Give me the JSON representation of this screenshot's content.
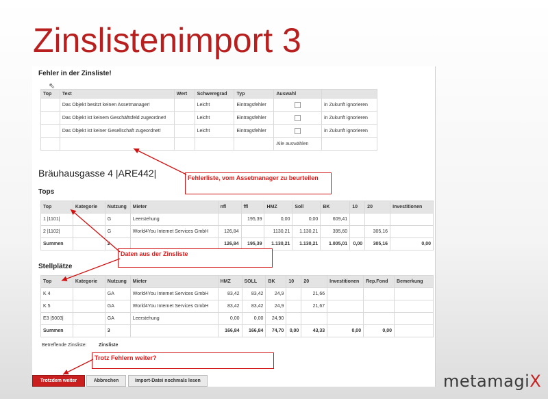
{
  "slide": {
    "title": "Zinslistenimport 3",
    "logo_main": "metamagi",
    "logo_accent": "X"
  },
  "errors": {
    "heading": "Fehler in der Zinsliste!",
    "columns": [
      "Top",
      "Text",
      "Wert",
      "Schweregrad",
      "Typ",
      "Auswahl",
      ""
    ],
    "rows": [
      {
        "top": "",
        "text": "Das Objekt besitzt keinen Assetmanager!",
        "wert": "",
        "severity": "Leicht",
        "typ": "Eintragsfehler",
        "ignore": "in Zukunft ignorieren"
      },
      {
        "top": "",
        "text": "Das Objekt ist keinem Geschäftsfeld zugeordnet!",
        "wert": "",
        "severity": "Leicht",
        "typ": "Eintragsfehler",
        "ignore": "in Zukunft ignorieren"
      },
      {
        "top": "",
        "text": "Das Objekt ist keiner Gesellschaft zugeordnet!",
        "wert": "",
        "severity": "Leicht",
        "typ": "Eintragsfehler",
        "ignore": "in Zukunft ignorieren"
      }
    ],
    "select_all": "Alle auswählen"
  },
  "object_title": "Bräuhausgasse 4 |ARE442|",
  "tops": {
    "heading": "Tops",
    "columns": [
      "Top",
      "Kategorie",
      "Nutzung",
      "Mieter",
      "nfl",
      "ffl",
      "HMZ",
      "Soll",
      "BK",
      "10",
      "20",
      "Investitionen"
    ],
    "rows": [
      [
        "1 |1101|",
        "",
        "G",
        "Leerstehung",
        "",
        "195,39",
        "0,00",
        "0,00",
        "609,41",
        "",
        "",
        ""
      ],
      [
        "2 |1102|",
        "",
        "G",
        "World4You Internet Services GmbH",
        "126,84",
        "",
        "1130,21",
        "1.130,21",
        "395,60",
        "",
        "305,16",
        ""
      ]
    ],
    "sum": [
      "Summen",
      "",
      "2",
      "",
      "126,84",
      "195,39",
      "1.130,21",
      "1.130,21",
      "1.005,01",
      "0,00",
      "305,16",
      "0,00"
    ]
  },
  "parking": {
    "heading": "Stellplätze",
    "columns": [
      "Top",
      "Kategorie",
      "Nutzung",
      "Mieter",
      "HMZ",
      "SOLL",
      "BK",
      "10",
      "20",
      "Investitionen",
      "Rep.Fond",
      "Bemerkung"
    ],
    "rows": [
      [
        "K 4",
        "",
        "GA",
        "World4You Internet Services GmbH",
        "83,42",
        "83,42",
        "24,9",
        "",
        "21,66",
        "",
        "",
        ""
      ],
      [
        "K 5",
        "",
        "GA",
        "World4You Internet Services GmbH",
        "83,42",
        "83,42",
        "24,9",
        "",
        "21,67",
        "",
        "",
        ""
      ],
      [
        "E3 |5003|",
        "",
        "GA",
        "Leerstehung",
        "0,00",
        "0,00",
        "24,90",
        "",
        "",
        "",
        "",
        ""
      ]
    ],
    "sum": [
      "Summen",
      "",
      "3",
      "",
      "166,84",
      "166,84",
      "74,70",
      "0,00",
      "43,33",
      "0,00",
      "0,00",
      ""
    ]
  },
  "footer": {
    "label": "Betreffende Zinsliste:",
    "value": "Zinsliste"
  },
  "callouts": {
    "errors": "Fehlerliste, vom Assetmanager zu beurteilen",
    "data": "Daten aus der Zinsliste",
    "continue": "Trotz Fehlern weiter?"
  },
  "buttons": {
    "continue": "Trotzdem weiter",
    "cancel": "Abbrechen",
    "reread": "Import-Datei nochmals lesen"
  }
}
